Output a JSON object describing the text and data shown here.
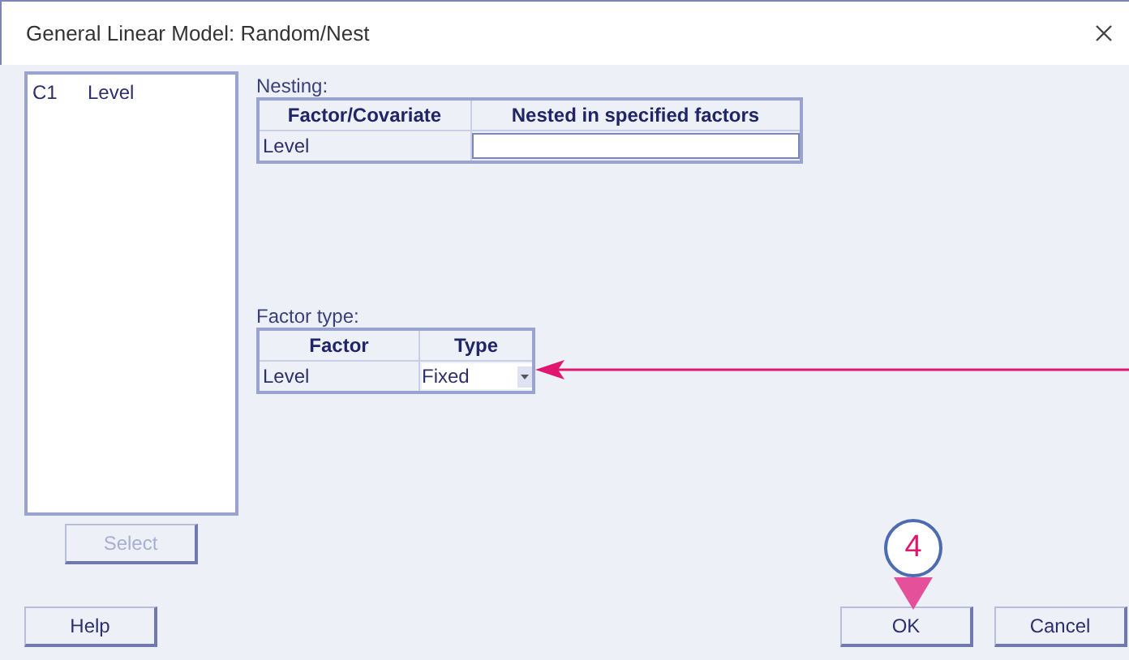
{
  "window": {
    "title": "General Linear Model: Random/Nest"
  },
  "variables": [
    {
      "column": "C1",
      "name": "Level"
    }
  ],
  "nesting": {
    "label": "Nesting:",
    "columns": [
      "Factor/Covariate",
      "Nested in specified factors"
    ],
    "rows": [
      {
        "factor": "Level"
      }
    ]
  },
  "factor_type": {
    "label": "Factor type:",
    "columns": [
      "Factor",
      "Type"
    ],
    "rows": [
      {
        "factor": "Level",
        "type": "Fixed"
      }
    ]
  },
  "select_button": {
    "label": "Select",
    "disabled": true
  },
  "buttons": [
    {
      "label": "Help",
      "kind": "left"
    },
    {
      "label": "OK",
      "kind": "right"
    },
    {
      "label": "Cancel",
      "kind": "right"
    }
  ],
  "callout": {
    "number": "4"
  }
}
